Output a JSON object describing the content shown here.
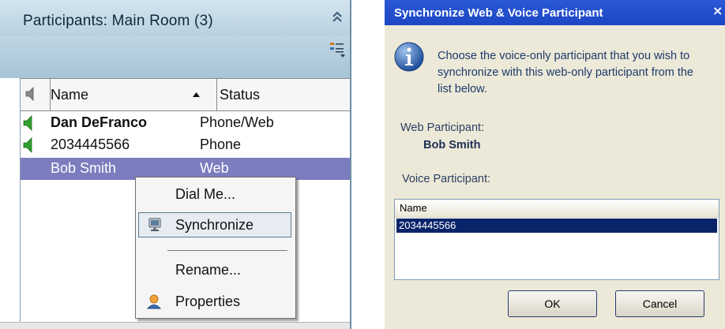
{
  "participants_panel": {
    "title": "Participants: Main Room (3)",
    "icons": {
      "collapse": "double-chevron-up-icon",
      "view_options": "list-view-dropdown-icon"
    },
    "columns": {
      "speaker_icon": "speaker-icon",
      "name": "Name",
      "status": "Status"
    },
    "rows": [
      {
        "name": "Dan DeFranco",
        "status": "Phone/Web",
        "speaker": true,
        "bold": true,
        "selected": false
      },
      {
        "name": "2034445566",
        "status": "Phone",
        "speaker": true,
        "bold": false,
        "selected": false
      },
      {
        "name": "Bob Smith",
        "status": "Web",
        "speaker": false,
        "bold": false,
        "selected": true
      }
    ]
  },
  "context_menu": {
    "items": [
      {
        "label": "Dial Me...",
        "icon": null
      },
      {
        "label": "Synchronize",
        "icon": "computer-icon",
        "highlighted": true
      },
      {
        "label": "Rename...",
        "icon": null
      },
      {
        "label": "Properties",
        "icon": "person-icon"
      }
    ]
  },
  "sync_dialog": {
    "title": "Synchronize Web & Voice Participant",
    "close": "×",
    "message": "Choose the voice-only participant that you wish to synchronize with this web-only participant from the list below.",
    "web_participant_label": "Web Participant:",
    "web_participant_value": "Bob Smith",
    "voice_participant_label": "Voice Participant:",
    "list_header": "Name",
    "list_items": [
      "2034445566"
    ],
    "ok": "OK",
    "cancel": "Cancel"
  },
  "colors": {
    "selection": "#7b7dbf",
    "dialog_title": "#2a58d6",
    "list_selection": "#0a246a",
    "speaker_green": "#2fa12f"
  }
}
